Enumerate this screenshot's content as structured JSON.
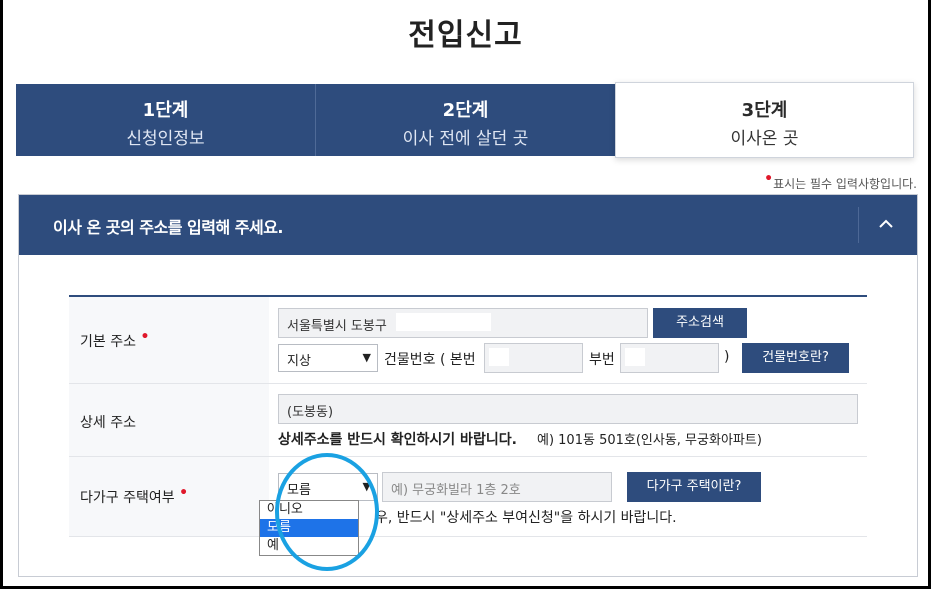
{
  "page_title": "전입신고",
  "steps": [
    {
      "num": "1단계",
      "name": "신청인정보"
    },
    {
      "num": "2단계",
      "name": "이사 전에 살던 곳"
    },
    {
      "num": "3단계",
      "name": "이사온 곳"
    }
  ],
  "required_note": "표시는 필수 입력사항입니다.",
  "panel": {
    "title": "이사 온 곳의 주소를 입력해 주세요.",
    "collapse_icon": "chevron-up-icon"
  },
  "form": {
    "basic_address": {
      "label": "기본 주소",
      "value": "서울특별시 도봉구",
      "search_button": "주소검색",
      "ground_select": "지상",
      "building_number_label": "건물번호 ( 본번",
      "sub_number_label": "부번",
      "close_paren": ")",
      "building_info_button": "건물번호란?"
    },
    "detail_address": {
      "label": "상세 주소",
      "value": "(도봉동)",
      "notice_bold": "상세주소를 반드시 확인하시기 바랍니다.",
      "notice_example": "예) 101동 501호(인사동, 무궁화아파트)"
    },
    "multi_family": {
      "label": "다가구 주택여부",
      "select_value": "모름",
      "input_placeholder": "예) 무궁화빌라 1층 2호",
      "info_button": "다가구 주택이란?",
      "note": "우, 반드시 \"상세주소 부여신청\"을 하시기 바랍니다.",
      "options": [
        "아니오",
        "모름",
        "예"
      ],
      "selected_option": "모름"
    }
  },
  "colors": {
    "primary": "#2e4c7d",
    "required": "#e0182b",
    "highlight_circle": "#1aa1e2",
    "option_selected": "#1e73e8"
  }
}
